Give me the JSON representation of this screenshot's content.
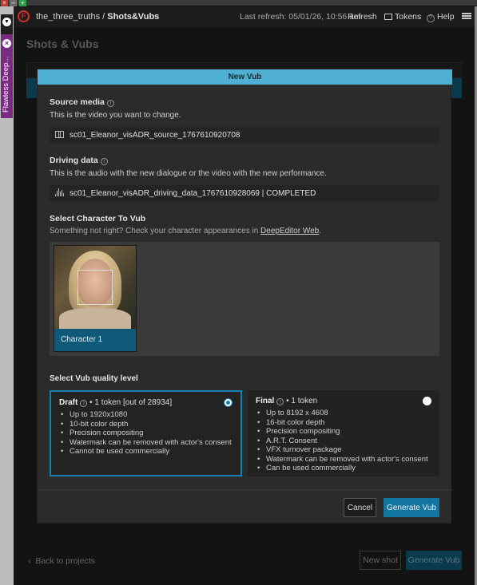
{
  "window": {
    "close_glyph": "×",
    "min_glyph": "–",
    "max_glyph": "+"
  },
  "plugin_strip": {
    "tab_label": "Flawless Deep..."
  },
  "topbar": {
    "logo_letter": "F",
    "project": "the_three_truths",
    "separator": " / ",
    "section": "Shots&Vubs",
    "last_refresh": "Last refresh: 05/01/26, 10:56 am",
    "refresh_label": "Refresh",
    "tokens_label": "Tokens",
    "help_label": "Help"
  },
  "page": {
    "title": "Shots & Vubs",
    "back_label": "Back to projects",
    "new_shot_label": "New shot",
    "generate_label": "Generate Vub"
  },
  "modal": {
    "title": "New Vub",
    "source_media": {
      "title": "Source media",
      "desc": "This is the video you want to change.",
      "value": "sc01_Eleanor_visADR_source_1767610920708"
    },
    "driving_data": {
      "title": "Driving data",
      "desc": "This is the audio with the new dialogue or the video with the new performance.",
      "value": "sc01_Eleanor_visADR_driving_data_1767610928069 | COMPLETED"
    },
    "character": {
      "title": "Select Character To Vub",
      "hint_prefix": "Something not right? Check your character appearances in ",
      "hint_link": "DeepEditor Web",
      "hint_suffix": ".",
      "cards": [
        {
          "label": "Character 1",
          "selected": true
        }
      ]
    },
    "quality": {
      "title": "Select Vub quality level",
      "options": [
        {
          "name": "Draft",
          "cost": " • 1 token [out of 28934]",
          "selected": true,
          "features": [
            "Up to 1920x1080",
            "10-bit color depth",
            "Precision compositing",
            "Watermark can be removed with actor's consent",
            "Cannot be used commercially"
          ]
        },
        {
          "name": "Final",
          "cost": " • 1 token",
          "selected": false,
          "features": [
            "Up to 8192 x 4608",
            "16-bit color depth",
            "Precision compositing",
            "A.R.T. Consent",
            "VFX turnover package",
            "Watermark can be removed with actor's consent",
            "Can be used commercially"
          ]
        }
      ]
    },
    "cancel_label": "Cancel",
    "generate_label": "Generate Vub"
  },
  "colors": {
    "accent": "#1274a0",
    "header": "#4fb0d3",
    "brand_red": "#d9302c",
    "plugin_purple": "#7a2a80"
  }
}
